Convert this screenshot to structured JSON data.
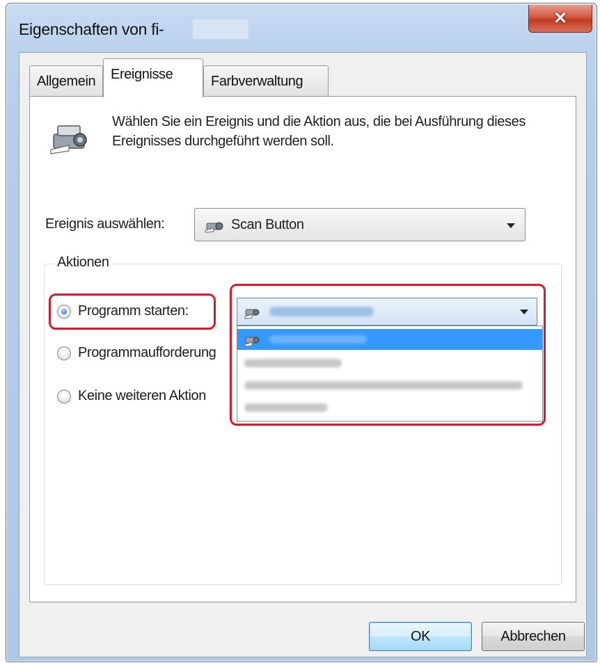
{
  "window": {
    "title": "Eigenschaften von fi-"
  },
  "tabs": [
    {
      "label": "Allgemein",
      "active": false
    },
    {
      "label": "Ereignisse",
      "active": true
    },
    {
      "label": "Farbverwaltung",
      "active": false
    }
  ],
  "intro": {
    "text": "Wählen Sie ein Ereignis und die Aktion aus, die bei Ausführung dieses Ereignisses durchgeführt werden soll.",
    "icon": "scanner-icon"
  },
  "event": {
    "label": "Ereignis auswählen:",
    "selected": "Scan Button"
  },
  "actions": {
    "title": "Aktionen",
    "options": [
      {
        "label": "Programm starten:",
        "checked": true
      },
      {
        "label": "Programmaufforderung",
        "checked": false
      },
      {
        "label": "Keine weiteren Aktion",
        "checked": false
      }
    ]
  },
  "colors": {
    "highlight": "#e0162b",
    "selection": "#3399ff"
  },
  "buttons": {
    "ok": "OK",
    "cancel": "Abbrechen"
  }
}
